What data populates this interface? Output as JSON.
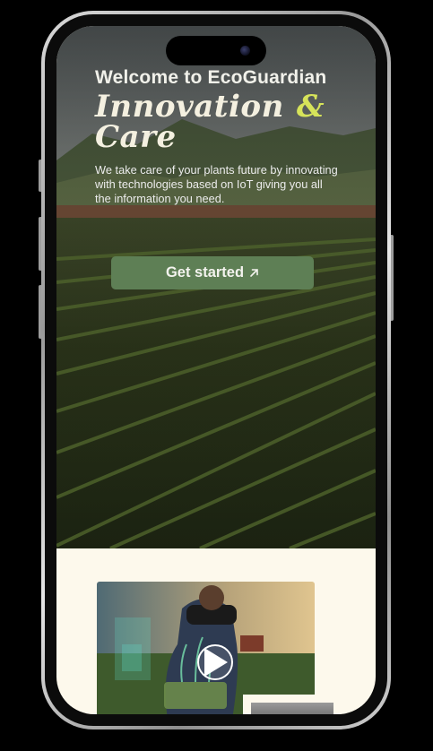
{
  "hero": {
    "welcome": "Welcome to EcoGuardian",
    "headline_line1": "Innovation",
    "headline_amp": "&",
    "headline_line2": "Care",
    "description": "We take care of your plants future by innovating with technologies based on IoT giving you all the information you need.",
    "cta_label": "Get started",
    "cta_icon": "arrow-up-right-icon"
  },
  "media": {
    "video_icon": "play-icon"
  },
  "colors": {
    "accent": "#5e7f55",
    "script_accent": "#d6e35a",
    "cream_bg": "#fdf9ec"
  }
}
